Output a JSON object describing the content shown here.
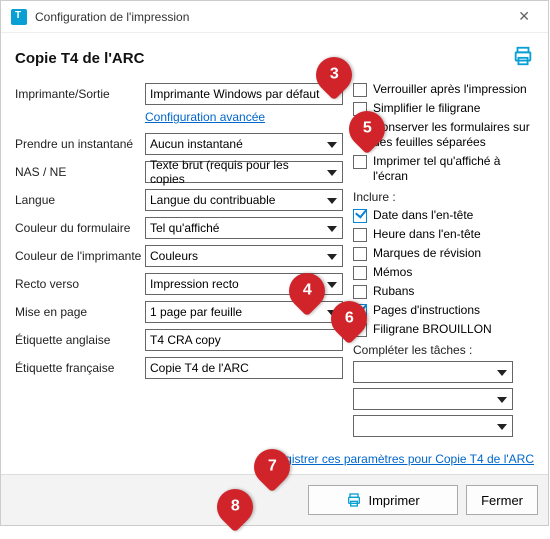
{
  "window": {
    "title": "Configuration de l'impression"
  },
  "header": {
    "title": "Copie T4 de l'ARC"
  },
  "form": {
    "printer_label": "Imprimante/Sortie",
    "printer_value": "Imprimante Windows par défaut",
    "advanced_link": "Configuration avancée",
    "snapshot_label": "Prendre un instantané",
    "snapshot_value": "Aucun instantané",
    "nas_label": "NAS / NE",
    "nas_value": "Texte brut (requis pour les copies",
    "language_label": "Langue",
    "language_value": "Langue du contribuable",
    "form_color_label": "Couleur du formulaire",
    "form_color_value": "Tel qu'affiché",
    "printer_color_label": "Couleur de l'imprimante",
    "printer_color_value": "Couleurs",
    "duplex_label": "Recto verso",
    "duplex_value": "Impression recto",
    "layout_label": "Mise en page",
    "layout_value": "1 page par feuille",
    "label_en_label": "Étiquette anglaise",
    "label_en_value": "T4 CRA copy",
    "label_fr_label": "Étiquette française",
    "label_fr_value": "Copie T4 de l'ARC"
  },
  "options": {
    "lock": "Verrouiller après l'impression",
    "simplify": "Simplifier le filigrane",
    "separate": "Conserver les formulaires sur des feuilles séparées",
    "asis": "Imprimer tel qu'affiché à l'écran",
    "include_label": "Inclure :",
    "date": "Date dans l'en-tête",
    "time": "Heure dans l'en-tête",
    "review": "Marques de révision",
    "memos": "Mémos",
    "ribbons": "Rubans",
    "pages": "Pages d'instructions",
    "draft": "Filigrane BROUILLON",
    "complete_label": "Compléter les tâches :"
  },
  "save_link": "Enregistrer ces paramètres pour Copie T4 de l'ARC",
  "footer": {
    "print": "Imprimer",
    "close": "Fermer"
  },
  "callouts": {
    "c3": "3",
    "c4": "4",
    "c5": "5",
    "c6": "6",
    "c7": "7",
    "c8": "8"
  }
}
